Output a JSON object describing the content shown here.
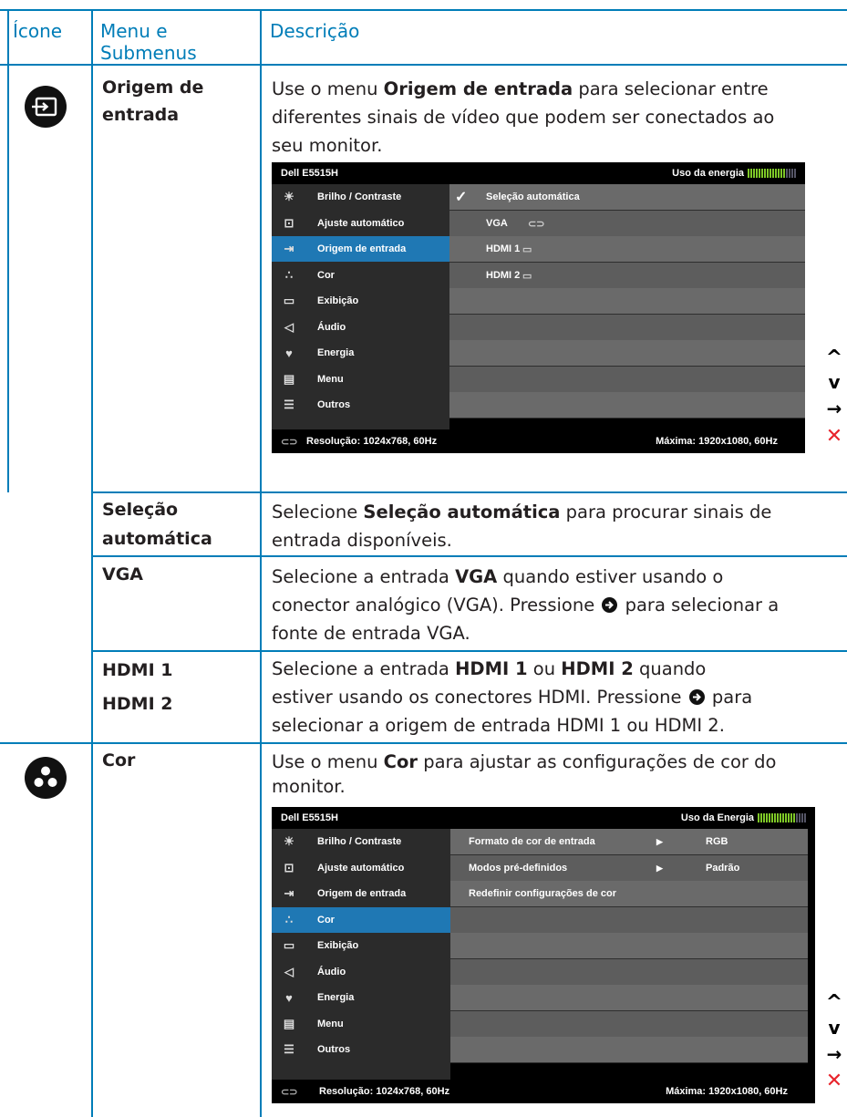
{
  "headers": {
    "icon": "Ícone",
    "menu": "Menu e Submenus",
    "menu_l1": "Menu e",
    "menu_l2": "Submenus",
    "desc": "Descrição"
  },
  "input_section": {
    "icon": "input-source-icon",
    "menu_l1": "Origem de",
    "menu_l2": "entrada",
    "desc_l1_pre": "Use o menu ",
    "desc_l1_bold": "Origem de entrada",
    "desc_l1_post": " para selecionar entre",
    "desc_l2": "diferentes sinais de vídeo que podem ser conectados ao",
    "desc_l3": "seu monitor.",
    "osd": {
      "title": "Dell E5515H",
      "energy_label": "Uso da energia",
      "energy_level": 0.8,
      "menu": [
        "Brilho / Contraste",
        "Ajuste automático",
        "Origem de entrada",
        "Cor",
        "Exibição",
        "Áudio",
        "Energia",
        "Menu",
        "Outros"
      ],
      "selected_index": 2,
      "options": [
        "Seleção automática",
        "VGA",
        "HDMI 1",
        "HDMI 2"
      ],
      "checked_option": "Seleção automática",
      "footer_left": "Resolução: 1024x768, 60Hz",
      "footer_right": "Máxima: 1920x1080, 60Hz"
    }
  },
  "auto_row": {
    "menu_l1": "Seleção",
    "menu_l2": "automática",
    "pre": "Selecione ",
    "bold": "Seleção automática",
    "post": " para procurar sinais de",
    "l2": "entrada disponíveis."
  },
  "vga_row": {
    "menu": "VGA",
    "pre": "Selecione a entrada ",
    "bold": "VGA",
    "post": " quando estiver usando o",
    "l2_pre": "conector analógico (VGA). Pressione ",
    "l2_post": " para selecionar a",
    "l3": "fonte de entrada VGA."
  },
  "hdmi_row": {
    "menu_l1": "HDMI 1",
    "menu_l2": "HDMI 2",
    "pre": "Selecione a entrada ",
    "bold1": "HDMI 1",
    "mid": " ou ",
    "bold2": "HDMI 2",
    "post": " quando",
    "l2_pre": "estiver usando os conectores HDMI. Pressione ",
    "l2_post": " para",
    "l3": "selecionar a origem de entrada HDMI 1 ou HDMI 2."
  },
  "color_section": {
    "icon": "color-icon",
    "menu": "Cor",
    "desc_l1_pre": "Use o menu ",
    "desc_l1_bold": "Cor",
    "desc_l1_post": " para ajustar as configurações de cor do",
    "desc_l2": "monitor.",
    "osd": {
      "title": "Dell E5515H",
      "energy_label": "Uso da Energia",
      "energy_level": 0.8,
      "menu": [
        "Brilho / Contraste",
        "Ajuste automático",
        "Origem de entrada",
        "Cor",
        "Exibição",
        "Áudio",
        "Energia",
        "Menu",
        "Outros"
      ],
      "selected_index": 3,
      "rows": [
        {
          "label": "Formato de cor de entrada",
          "value": "RGB"
        },
        {
          "label": "Modos pré-definidos",
          "value": "Padrão"
        },
        {
          "label": "Redefinir configurações de cor",
          "value": ""
        }
      ],
      "footer_left": "Resolução: 1024x768, 60Hz",
      "footer_right": "Máxima: 1920x1080, 60Hz"
    }
  },
  "controls": {
    "up": "^",
    "down": "v",
    "enter": "→",
    "exit": "✕"
  },
  "colors": {
    "accent": "#007db8",
    "osd_selected": "#1f78b4",
    "exit": "#e8242c",
    "energy_on": "#7ec827"
  }
}
